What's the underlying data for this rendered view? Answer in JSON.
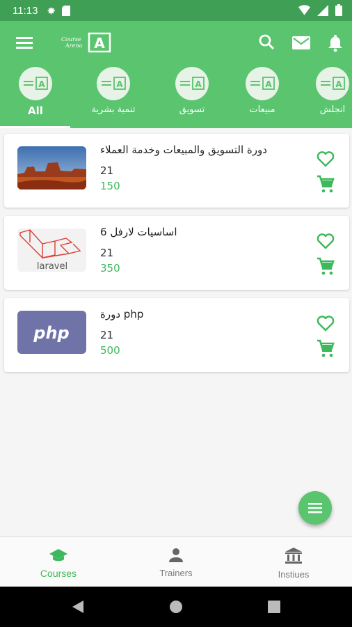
{
  "status_bar": {
    "time": "11:13"
  },
  "app_bar": {
    "logo_line1": "Course",
    "logo_line2": "Arena",
    "logo_letter": "A"
  },
  "categories": [
    {
      "label": "All",
      "active": true
    },
    {
      "label": "تنمية بشرية"
    },
    {
      "label": "تسويق"
    },
    {
      "label": "مبيعات"
    },
    {
      "label": "انجلش"
    }
  ],
  "courses": [
    {
      "title": "دورة التسويق والمبيعات وخدمة العملاء",
      "count": "21",
      "price": "150",
      "image": "desert-landscape-thumbnail"
    },
    {
      "title": "اساسيات لارفل 6",
      "count": "21",
      "price": "350",
      "image": "laravel-logo-thumbnail",
      "image_text": "laravel"
    },
    {
      "title": "دورة php",
      "count": "21",
      "price": "500",
      "image": "php-logo-thumbnail",
      "image_text": "php"
    }
  ],
  "bottom_nav": [
    {
      "label": "Courses",
      "icon": "graduation-cap-icon",
      "active": true
    },
    {
      "label": "Trainers",
      "icon": "person-icon"
    },
    {
      "label": "Instiues",
      "icon": "institution-icon"
    }
  ],
  "colors": {
    "primary": "#5ac46f",
    "primary_dark": "#3f9f55",
    "accent_text": "#3cb95a"
  }
}
